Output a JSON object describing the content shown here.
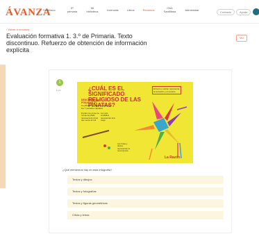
{
  "header": {
    "logo": "ÁVANZA",
    "logo_sub": "Santillana",
    "nav": [
      {
        "label": "6º primaria",
        "active": false
      },
      {
        "label": "Mi biblioteca",
        "active": false
      },
      {
        "label": "Licencias",
        "active": false
      },
      {
        "label": "Libros",
        "active": false
      },
      {
        "label": "Recursos",
        "active": true
      },
      {
        "label": "Club Santillana",
        "active": false
      },
      {
        "label": "Administrar",
        "active": false
      }
    ],
    "contact_label": "Contacto",
    "help_label": "Ayuda"
  },
  "breadcrumb": "‹ Volver a recursos",
  "page_title": "Evaluación formativa 1. 3.º de Primaria. Texto discontinuo. Refuerzo de obtención de información explícita",
  "view_button": "Ver",
  "question_block": {
    "number": "1",
    "points": "1 pto",
    "infographic": {
      "title": "¿CUÁL ES EL SIGNIFICADO RELIGIOSO DE LAS PIÑATAS?",
      "side_note": "El barro o cartón representa la tentación y el pecado",
      "subtitle": "DESCUBRE LAS POSADAS",
      "subtitle_text": "La piñata de 7 picos representa los 7 pecados capitales",
      "col1": "El palo con el que se rompe la piñata representa la virtud que vence al mal",
      "col2": "Los ojos vendados representan la fe ciega",
      "col3": "Las frutas y dulces representan la recompensa",
      "brand": "La Razón",
      "colors": {
        "background": "#f2e634",
        "accent": "#c8302b"
      }
    },
    "question": "¿Qué elementos hay en esta infografía?",
    "options": [
      "Textos y dibujos",
      "Textos y fotografías",
      "Textos y figuras geométricas",
      "Cifras y letras"
    ]
  },
  "colors": {
    "brand": "#e85a2a",
    "option_bg": "#fbf6dd",
    "side_accent": "#f6d7b6",
    "badge_green": "#9bc54a"
  }
}
